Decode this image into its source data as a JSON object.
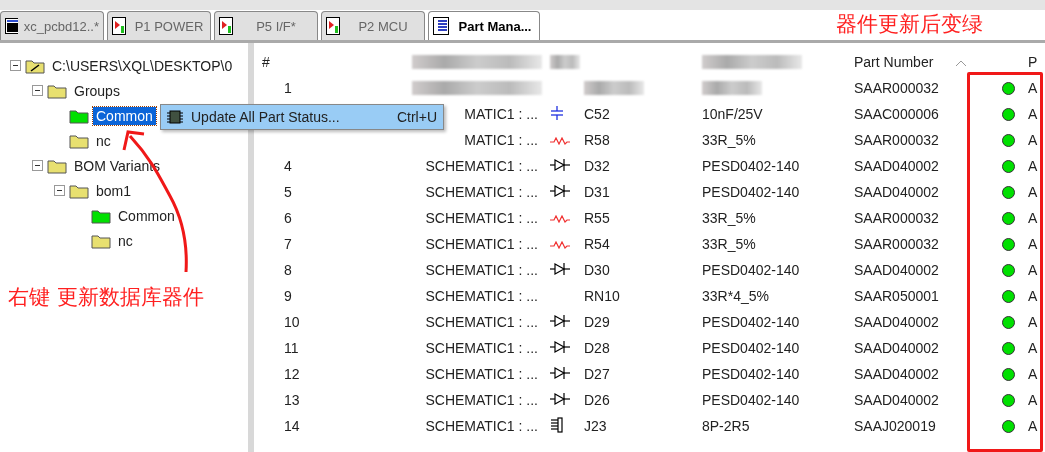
{
  "tabs": [
    {
      "label": "xc_pcbd12..*",
      "kind": "board",
      "selected": false
    },
    {
      "label": "P1 POWER",
      "kind": "schematic",
      "selected": false
    },
    {
      "label": "P5 I/F*",
      "kind": "schematic",
      "selected": false
    },
    {
      "label": "P2 MCU",
      "kind": "schematic",
      "selected": false
    },
    {
      "label": "Part Mana...",
      "kind": "table",
      "selected": true
    }
  ],
  "tree": [
    {
      "label": "C:\\USERS\\XQL\\DESKTOP\\0",
      "kind": "root",
      "expanded": true,
      "selected": false,
      "children": [
        {
          "label": "Groups",
          "kind": "folder",
          "color": "#e8e070",
          "expanded": true,
          "selected": false,
          "children": [
            {
              "label": "Common",
              "kind": "folder",
              "color": "#00e000",
              "selected": true
            },
            {
              "label": "nc",
              "kind": "folder",
              "color": "#e8e070",
              "selected": false
            }
          ]
        },
        {
          "label": "BOM Variants",
          "kind": "folder",
          "color": "#e8e070",
          "expanded": true,
          "selected": false,
          "children": [
            {
              "label": "bom1",
              "kind": "folder",
              "color": "#e8e070",
              "expanded": true,
              "selected": false,
              "children": [
                {
                  "label": "Common",
                  "kind": "folder",
                  "color": "#00e000",
                  "selected": false
                },
                {
                  "label": "nc",
                  "kind": "folder",
                  "color": "#e8e070",
                  "selected": false
                }
              ]
            }
          ]
        }
      ]
    }
  ],
  "context_menu": {
    "label": "Update All Part Status...",
    "shortcut": "Ctrl+U"
  },
  "table": {
    "columns": [
      {
        "label": "#"
      },
      {
        "blurred": true
      },
      {
        "blurred": true
      },
      {
        "blurred": true
      },
      {
        "label": "Part Number",
        "sorted": true
      },
      {
        "label": "P"
      }
    ],
    "rows": [
      {
        "number": "1",
        "part_number": "SAAR000032",
        "color": "#00e000",
        "status": "A"
      },
      {
        "source": "MATIC1 : ...",
        "kind": "capacitor",
        "ref": "C52",
        "value": "10nF/25V",
        "part_number": "SAAC000006",
        "color": "#00e000",
        "status": "A"
      },
      {
        "source": "MATIC1 : ...",
        "kind": "resistor",
        "ref": "R58",
        "value": "33R_5%",
        "part_number": "SAAR000032",
        "color": "#00e000",
        "status": "A"
      },
      {
        "number": "4",
        "source": "SCHEMATIC1 : ...",
        "kind": "diode",
        "ref": "D32",
        "value": "PESD0402-140",
        "part_number": "SAAD040002",
        "color": "#00e000",
        "status": "A"
      },
      {
        "number": "5",
        "source": "SCHEMATIC1 : ...",
        "kind": "diode",
        "ref": "D31",
        "value": "PESD0402-140",
        "part_number": "SAAD040002",
        "color": "#00e000",
        "status": "A"
      },
      {
        "number": "6",
        "source": "SCHEMATIC1 : ...",
        "kind": "resistor",
        "ref": "R55",
        "value": "33R_5%",
        "part_number": "SAAR000032",
        "color": "#00e000",
        "status": "A"
      },
      {
        "number": "7",
        "source": "SCHEMATIC1 : ...",
        "kind": "resistor",
        "ref": "R54",
        "value": "33R_5%",
        "part_number": "SAAR000032",
        "color": "#00e000",
        "status": "A"
      },
      {
        "number": "8",
        "source": "SCHEMATIC1 : ...",
        "kind": "diode",
        "ref": "D30",
        "value": "PESD0402-140",
        "part_number": "SAAD040002",
        "color": "#00e000",
        "status": "A"
      },
      {
        "number": "9",
        "source": "SCHEMATIC1 : ...",
        "ref": "RN10",
        "value": "33R*4_5%",
        "part_number": "SAAR050001",
        "color": "#00e000",
        "status": "A"
      },
      {
        "number": "10",
        "source": "SCHEMATIC1 : ...",
        "kind": "diode",
        "ref": "D29",
        "value": "PESD0402-140",
        "part_number": "SAAD040002",
        "color": "#00e000",
        "status": "A"
      },
      {
        "number": "11",
        "source": "SCHEMATIC1 : ...",
        "kind": "diode",
        "ref": "D28",
        "value": "PESD0402-140",
        "part_number": "SAAD040002",
        "color": "#00e000",
        "status": "A"
      },
      {
        "number": "12",
        "source": "SCHEMATIC1 : ...",
        "kind": "diode",
        "ref": "D27",
        "value": "PESD0402-140",
        "part_number": "SAAD040002",
        "color": "#00e000",
        "status": "A"
      },
      {
        "number": "13",
        "source": "SCHEMATIC1 : ...",
        "kind": "diode",
        "ref": "D26",
        "value": "PESD0402-140",
        "part_number": "SAAD040002",
        "color": "#00e000",
        "status": "A"
      },
      {
        "number": "14",
        "source": "SCHEMATIC1 : ...",
        "kind": "connector",
        "ref": "J23",
        "value": "8P-2R5",
        "part_number": "SAAJ020019",
        "color": "#00e000",
        "status": "A"
      }
    ]
  },
  "annotations": [
    {
      "kind": "corner_note",
      "text": "器件更新后变绿"
    },
    {
      "kind": "side_note",
      "text": "右键 更新数据库器件"
    },
    {
      "kind": "frame"
    },
    {
      "kind": "arrow"
    }
  ]
}
